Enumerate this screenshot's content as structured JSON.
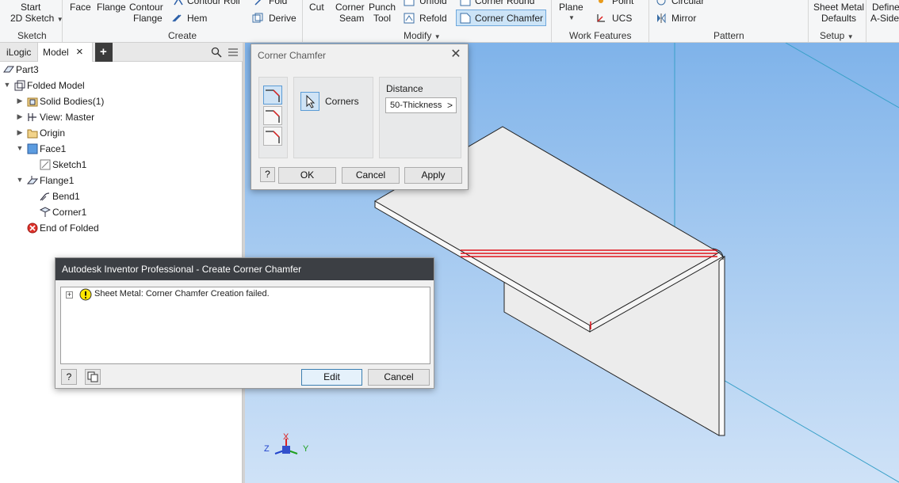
{
  "ribbon": {
    "start_sketch_l1": "Start",
    "start_sketch_l2": "2D Sketch",
    "face": "Face",
    "flange": "Flange",
    "contour_flange_l1": "Contour",
    "contour_flange_l2": "Flange",
    "contour_roll": "Contour Roll",
    "fold": "Fold",
    "hem": "Hem",
    "derive": "Derive",
    "cut": "Cut",
    "corner_seam_l1": "Corner",
    "corner_seam_l2": "Seam",
    "punch_tool_l1": "Punch",
    "punch_tool_l2": "Tool",
    "unfold": "Unfold",
    "refold": "Refold",
    "corner_round": "Corner Round",
    "corner_chamfer": "Corner Chamfer",
    "plane": "Plane",
    "point": "Point",
    "ucs": "UCS",
    "circular": "Circular",
    "mirror": "Mirror",
    "sheet_metal_defaults_l1": "Sheet Metal",
    "sheet_metal_defaults_l2": "Defaults",
    "define_aside_l1": "Define",
    "define_aside_l2": "A-Side",
    "groups": {
      "sketch": "Sketch",
      "create": "Create",
      "modify": "Modify",
      "work_features": "Work Features",
      "pattern": "Pattern",
      "setup": "Setup"
    }
  },
  "browser": {
    "tabs": {
      "ilogic": "iLogic",
      "model": "Model",
      "close": "×",
      "add": "+"
    },
    "tree": [
      {
        "label": "Part3"
      },
      {
        "label": "Folded Model"
      },
      {
        "label": "Solid Bodies(1)"
      },
      {
        "label": "View: Master"
      },
      {
        "label": "Origin"
      },
      {
        "label": "Face1"
      },
      {
        "label": "Sketch1"
      },
      {
        "label": "Flange1"
      },
      {
        "label": "Bend1"
      },
      {
        "label": "Corner1"
      },
      {
        "label": "End of Folded"
      }
    ]
  },
  "corner_chamfer_dialog": {
    "title": "Corner Chamfer",
    "corners_label": "Corners",
    "distance_label": "Distance",
    "distance_value": "50-Thickness",
    "ok": "OK",
    "cancel": "Cancel",
    "apply": "Apply",
    "help": "?"
  },
  "error_dialog": {
    "title": "Autodesk Inventor Professional - Create Corner Chamfer",
    "message": "Sheet Metal: Corner Chamfer Creation failed.",
    "edit": "Edit",
    "cancel": "Cancel",
    "help": "?"
  },
  "triad": {
    "x": "X",
    "y": "Y",
    "z": "Z"
  },
  "colors": {
    "accent": "#0078d7",
    "selection_red": "#e0131b",
    "error_red": "#e0322b",
    "warning_yellow": "#ffe600"
  }
}
